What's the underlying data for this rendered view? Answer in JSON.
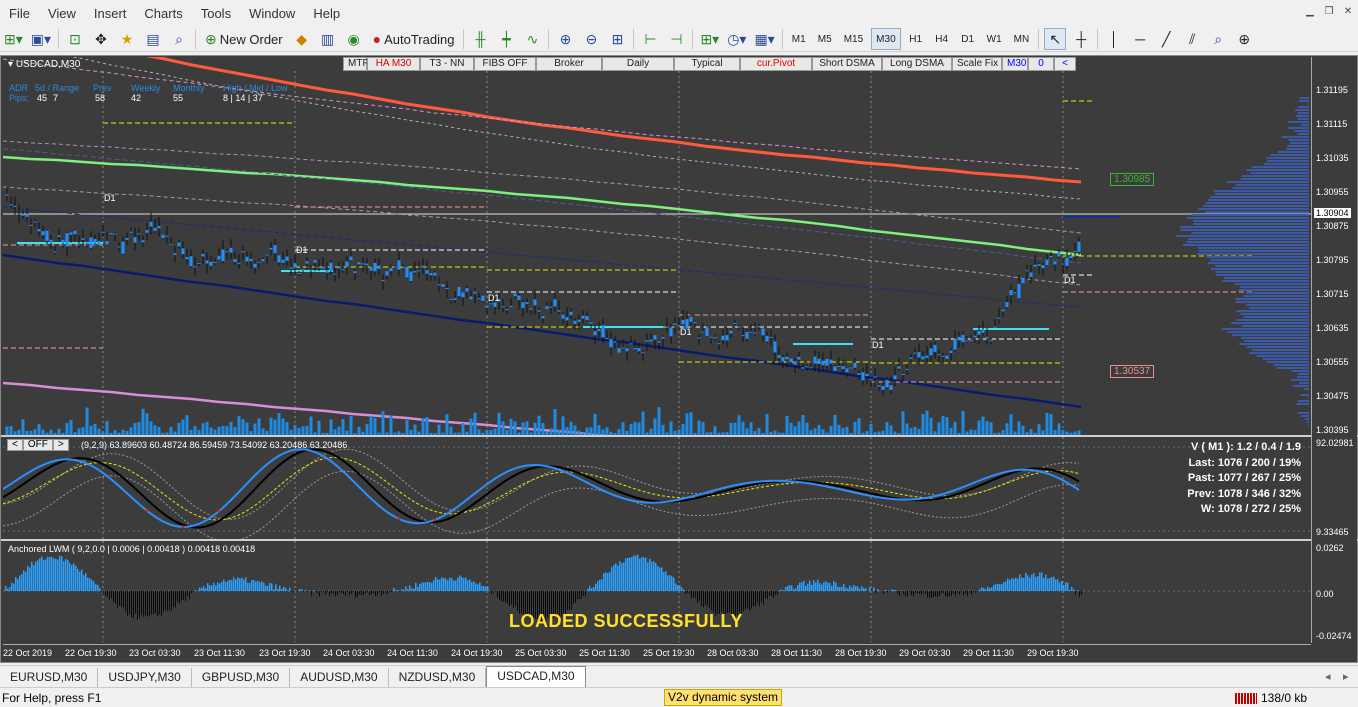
{
  "menu": [
    "File",
    "View",
    "Insert",
    "Charts",
    "Tools",
    "Window",
    "Help"
  ],
  "toolbar": {
    "new_order": "New Order",
    "autotrading": "AutoTrading",
    "timeframes": [
      "M1",
      "M5",
      "M15",
      "M30",
      "H1",
      "H4",
      "D1",
      "W1",
      "MN"
    ]
  },
  "chart": {
    "symbol": "USDCAD,M30",
    "buttons": [
      "MTF",
      "HA M30",
      "T3 - NN",
      "FIBS OFF",
      "Broker",
      "Daily",
      "Typical",
      "cur.Pivot",
      "Short DSMA",
      "Long DSMA",
      "Scale Fix",
      "M30",
      "0",
      "<"
    ],
    "adr": {
      "h_adr": "ADR",
      "h_range": "5d / Range",
      "h_prev": "Prev",
      "h_weekly": "Weekly",
      "h_monthly": "Monthly",
      "h_hml": "High / Mid / Low",
      "pips": "Pips:",
      "v_adr": "45",
      "v_range": "7",
      "v_prev": "58",
      "v_weekly": "42",
      "v_monthly": "55",
      "v_hml": "8  |  14  |  37"
    },
    "d1_label": "D1",
    "box_green": "1.30985",
    "box_red": "1.30537",
    "current_price": "1.30904",
    "price_ticks": [
      "1.31195",
      "1.31115",
      "1.31035",
      "1.30955",
      "1.30875",
      "1.30795",
      "1.30715",
      "1.30635",
      "1.30555",
      "1.30475",
      "1.30395"
    ],
    "time_ticks": [
      "22 Oct 2019",
      "22 Oct 19:30",
      "23 Oct 03:30",
      "23 Oct 11:30",
      "23 Oct 19:30",
      "24 Oct 03:30",
      "24 Oct 11:30",
      "24 Oct 19:30",
      "25 Oct 03:30",
      "25 Oct 11:30",
      "25 Oct 19:30",
      "28 Oct 03:30",
      "28 Oct 11:30",
      "28 Oct 19:30",
      "29 Oct 03:30",
      "29 Oct 11:30",
      "29 Oct 19:30"
    ]
  },
  "oscillator": {
    "buttons": [
      "<",
      "OFF",
      ">"
    ],
    "title": "(9,2,9) 63.89603 60.48724 86.59459 73.54092 63.20486 63.20486",
    "top": "92.02981",
    "bottom": "9.33465",
    "stats": [
      "V ( M1 ): 1.2 / 0.4 / 1.9",
      "Last: 1076 / 200 / 19%",
      "Past: 1077 / 267 / 25%",
      "Prev: 1078 / 346 / 32%",
      "W: 1078 / 272 / 25%"
    ]
  },
  "lwm": {
    "title": "Anchored LWM ( 9,2,0.0 | 0.0006 | 0.00418 ) 0.00418 0.00418",
    "top": "0.0262",
    "mid": "0.00",
    "bottom": "-0.02474",
    "loaded": "LOADED SUCCESSFULLY"
  },
  "tabs": [
    "EURUSD,M30",
    "USDJPY,M30",
    "GBPUSD,M30",
    "AUDUSD,M30",
    "NZDUSD,M30",
    "USDCAD,M30"
  ],
  "active_tab": "USDCAD,M30",
  "status": {
    "help": "For Help, press F1",
    "profile": "V2v dynamic system",
    "traffic": "138/0 kb"
  },
  "colors": {
    "bg": "#3c3c3c",
    "candle": "#1e90ff",
    "ema_red": "#ff5a3c",
    "ema_green": "#7ef07e",
    "trend_navy": "#0a1a6e",
    "violet": "#d68fd6",
    "yellow": "#e8e800",
    "osc_red": "#e02020"
  }
}
